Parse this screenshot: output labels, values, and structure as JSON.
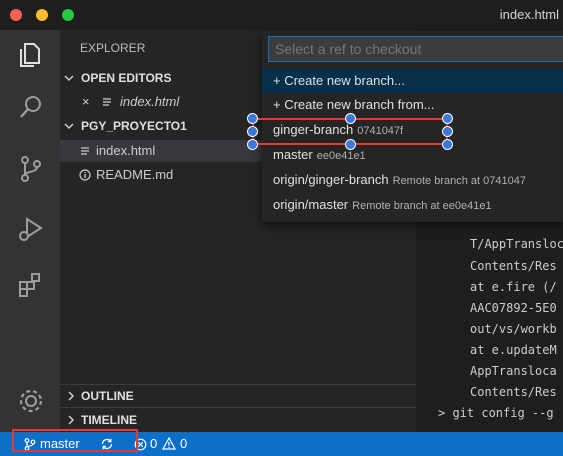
{
  "window": {
    "title": "index.html"
  },
  "activity_bar": {
    "icons": [
      "files-icon",
      "search-icon",
      "source-control-icon",
      "run-debug-icon",
      "extensions-icon",
      "gear-icon"
    ]
  },
  "sidebar": {
    "header": "EXPLORER",
    "open_editors": {
      "title": "OPEN EDITORS",
      "items": [
        {
          "close": "×",
          "name": "index.html"
        }
      ]
    },
    "project": {
      "title": "PGY_PROYECTO1",
      "files": [
        {
          "name": "index.html",
          "icon": "lines-file-icon"
        },
        {
          "name": "README.md",
          "icon": "info-file-icon"
        }
      ]
    },
    "outline": "OUTLINE",
    "timeline": "TIMELINE"
  },
  "quick_pick": {
    "placeholder": "Select a ref to checkout",
    "items": [
      {
        "label": "+ Create new branch...",
        "desc": ""
      },
      {
        "label": "+ Create new branch from...",
        "desc": ""
      },
      {
        "label": "ginger-branch",
        "desc": "0741047f"
      },
      {
        "label": "master",
        "desc": "ee0e41e1"
      },
      {
        "label": "origin/ginger-branch",
        "desc": "Remote branch at 0741047"
      },
      {
        "label": "origin/master",
        "desc": "Remote branch at ee0e41e1"
      }
    ]
  },
  "terminal": {
    "lines": [
      "T/AppTransloc",
      "Contents/Res",
      "at e.fire (/",
      "AAC07892-5E0",
      "out/vs/workb",
      "at e.updateM",
      "AppTransloca",
      "Contents/Res",
      "> git config --g"
    ]
  },
  "status_bar": {
    "branch": "master",
    "errors": "0",
    "warnings": "0"
  },
  "colors": {
    "accent": "#0e6fc9",
    "annotation": "#e53935",
    "handle": "#3b78d8"
  }
}
